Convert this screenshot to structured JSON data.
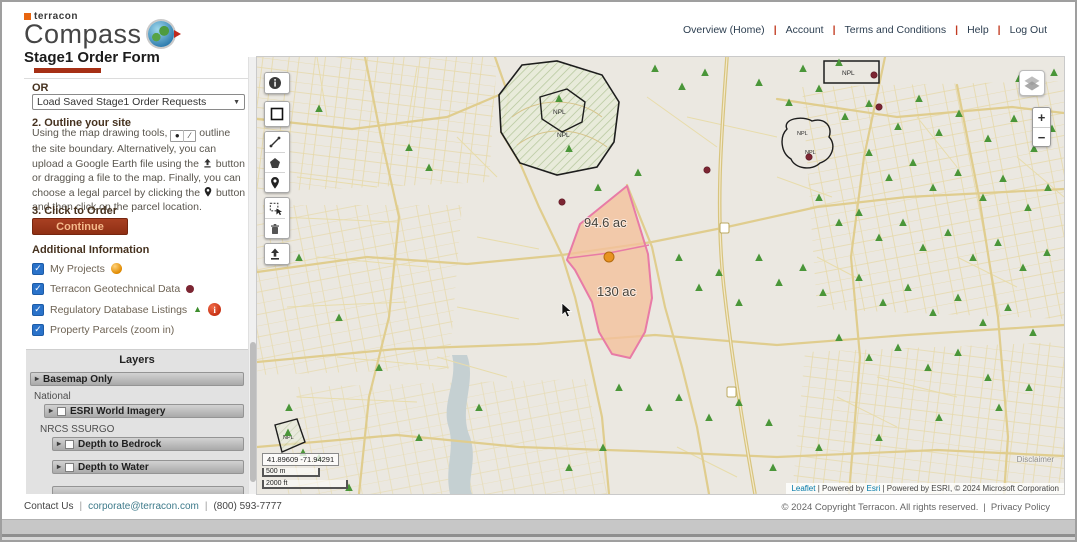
{
  "header": {
    "brand": "terracon",
    "product": "Compass",
    "nav": [
      "Overview (Home)",
      "Account",
      "Terms and Conditions",
      "Help",
      "Log Out"
    ],
    "nav_separator": "|"
  },
  "page_title": "Stage1 Order Form",
  "sidebar": {
    "or_label": "OR",
    "load_select": "Load Saved Stage1 Order Requests",
    "step2_title": "2. Outline your site",
    "step2_part1": "Using the map drawing tools,",
    "step2_part2": "outline the site boundary. Alternatively, you can upload a Google Earth file using the",
    "step2_part3": "button or dragging a file to the map. Finally, you can choose a legal parcel by clicking the",
    "step2_part4": "button and then click on the parcel location.",
    "step3_title": "3. Click to Order",
    "continue_label": "Continue",
    "additional_title": "Additional Information",
    "checkboxes": [
      {
        "label": "My Projects",
        "checked": true
      },
      {
        "label": "Terracon Geotechnical Data",
        "checked": true
      },
      {
        "label": "Regulatory Database Listings",
        "checked": true
      },
      {
        "label": "Property Parcels (zoom in)",
        "checked": true
      }
    ],
    "layers": {
      "title": "Layers",
      "basemap": "Basemap Only",
      "group_national": "National",
      "esri": "ESRI World Imagery",
      "group_ssurgo": "NRCS SSURGO",
      "bedrock": "Depth to Bedrock",
      "water": "Depth to Water"
    }
  },
  "map": {
    "zoom_in": "+",
    "zoom_out": "−",
    "npl_label": "NPL",
    "parcel_area_1": "94.6 ac",
    "parcel_area_2": "130 ac",
    "coordinates": "41.89609  -71.94291",
    "scale_metric": "500 m",
    "scale_imperial": "2000 ft",
    "disclaimer": "Disclaimer",
    "attribution_leaflet": "Leaflet",
    "attribution_mid": "| Powered by",
    "attribution_esri": "Esri",
    "attribution_tail": "| Powered by ESRI, © 2024 Microsoft Corporation"
  },
  "footer": {
    "contact": "Contact Us",
    "separator": "|",
    "email": "corporate@terracon.com",
    "phone": "(800) 593-7777",
    "copyright": "© 2024 Copyright Terracon. All rights reserved.",
    "privacy": "Privacy Policy"
  },
  "colors": {
    "accent_red": "#a63015",
    "continue_bg": "#9c3a1d",
    "checkbox_blue": "#2a72c9",
    "parcel_fill": "#f4c19c",
    "parcel_stroke": "#e87ba6",
    "tree_green": "#4a9639",
    "geotech_dot": "#7c2532"
  }
}
